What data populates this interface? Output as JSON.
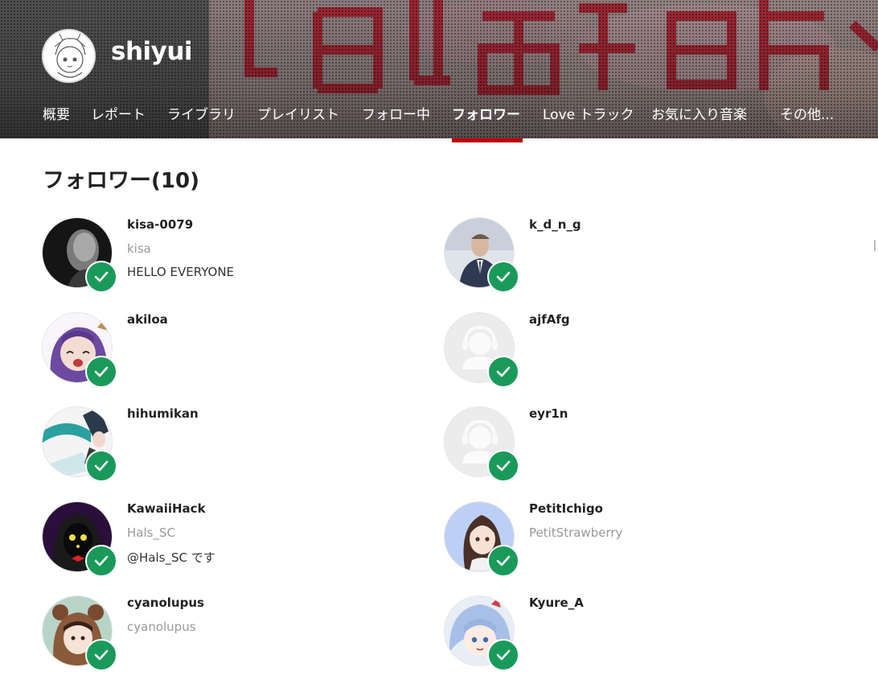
{
  "profile": {
    "name": "shiyui"
  },
  "nav": {
    "items": [
      {
        "label": "概要",
        "active": false
      },
      {
        "label": "レポート",
        "active": false
      },
      {
        "label": "ライブラリ",
        "active": false
      },
      {
        "label": "プレイリスト",
        "active": false
      },
      {
        "label": "フォロー中",
        "active": false
      },
      {
        "label": "フォロワー",
        "active": true
      },
      {
        "label": "Love トラック",
        "active": false
      },
      {
        "label": "お気に入り音楽",
        "active": false
      },
      {
        "label": "その他...",
        "active": false
      }
    ]
  },
  "section": {
    "title": "フォロワー",
    "count": "(10)"
  },
  "followers": [
    {
      "username": "kisa-0079",
      "realname": "kisa",
      "bio": "HELLO EVERYONE",
      "avatar": "dark-portrait",
      "following_back": true
    },
    {
      "username": "k_d_n_g",
      "realname": "",
      "bio": "",
      "avatar": "suit-portrait",
      "following_back": true
    },
    {
      "username": "akiloa",
      "realname": "",
      "bio": "",
      "avatar": "purple-anime",
      "following_back": true
    },
    {
      "username": "ajfAfg",
      "realname": "",
      "bio": "",
      "avatar": "default-user-icon",
      "following_back": true
    },
    {
      "username": "hihumikan",
      "realname": "",
      "bio": "",
      "avatar": "teal-anime",
      "following_back": true
    },
    {
      "username": "eyr1n",
      "realname": "",
      "bio": "",
      "avatar": "default-user-icon",
      "following_back": true
    },
    {
      "username": "KawaiiHack",
      "realname": "Hals_SC",
      "bio": "@Hals_SC です",
      "avatar": "hooded-figure",
      "following_back": true
    },
    {
      "username": "PetitIchigo",
      "realname": "PetitStrawberry",
      "bio": "",
      "avatar": "brown-hair-anime",
      "following_back": true
    },
    {
      "username": "cyanolupus",
      "realname": "cyanolupus",
      "bio": "",
      "avatar": "bear-hood-anime",
      "following_back": true
    },
    {
      "username": "Kyure_A",
      "realname": "",
      "bio": "",
      "avatar": "blue-hair-anime",
      "following_back": true
    }
  ],
  "colors": {
    "accent": "#c00000",
    "check": "#1a9a5a"
  }
}
